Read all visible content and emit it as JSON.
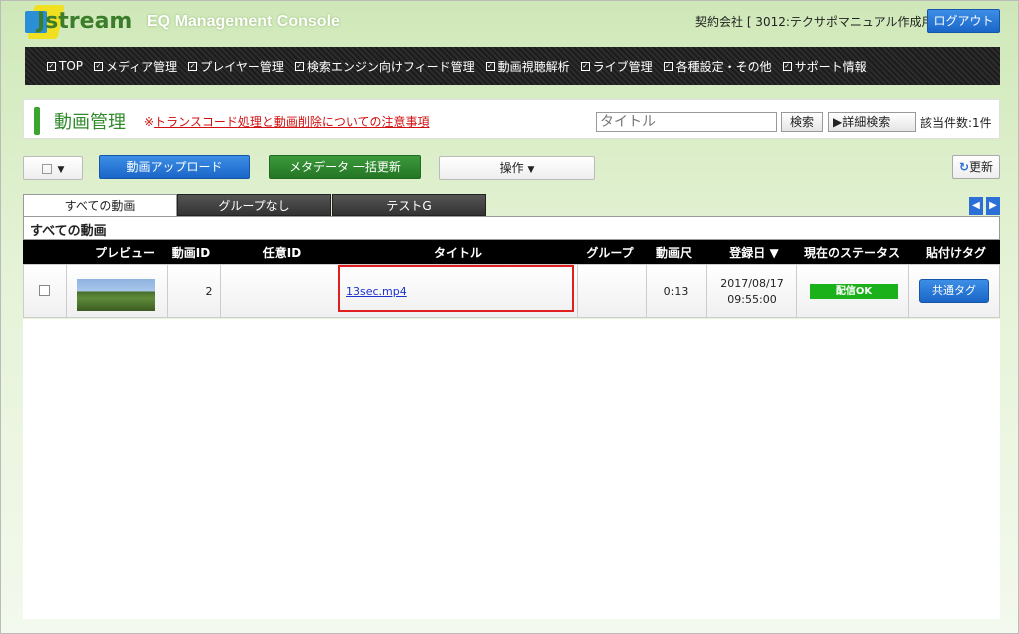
{
  "header": {
    "logo_text": "Jstream",
    "console_title": "EQ Management Console",
    "contract": "契約会社 [ 3012:テクサポマニュアル作成用 ]",
    "logout_label": "ログアウト"
  },
  "nav": {
    "items": [
      "TOP",
      "メディア管理",
      "プレイヤー管理",
      "検索エンジン向けフィード管理",
      "動画視聴解析",
      "ライブ管理",
      "各種設定・その他",
      "サポート情報"
    ]
  },
  "page": {
    "title": "動画管理",
    "notice_prefix": "※",
    "notice_link": "トランスコード処理と動画削除についての注意事項"
  },
  "search": {
    "placeholder": "タイトル",
    "search_label": "検索",
    "advanced_label": "詳細検索",
    "count": "該当件数:1件"
  },
  "toolbar": {
    "upload_label": "動画アップロード",
    "metadata_label": "メタデータ 一括更新",
    "ops_label": "操作",
    "refresh_label": "更新"
  },
  "tabs": {
    "all": "すべての動画",
    "none": "グループなし",
    "test": "テストG"
  },
  "panel": {
    "title": "すべての動画"
  },
  "table": {
    "headers": {
      "preview": "プレビュー",
      "id": "動画ID",
      "custom_id": "任意ID",
      "title": "タイトル",
      "group": "グループ",
      "duration": "動画尺",
      "date": "登録日 ▼",
      "status": "現在のステータス",
      "tag": "貼付けタグ"
    },
    "rows": [
      {
        "id": "2",
        "custom_id": "",
        "title": "13sec.mp4",
        "group": "",
        "duration": "0:13",
        "date": "2017/08/17",
        "time": "09:55:00",
        "status": "配信OK",
        "tag": "共通タグ"
      }
    ]
  },
  "colors": {
    "accent_green": "#3aa62d",
    "button_blue": "#1a66c8",
    "status_ok": "#1bb11b",
    "highlight_red": "#e02020"
  }
}
